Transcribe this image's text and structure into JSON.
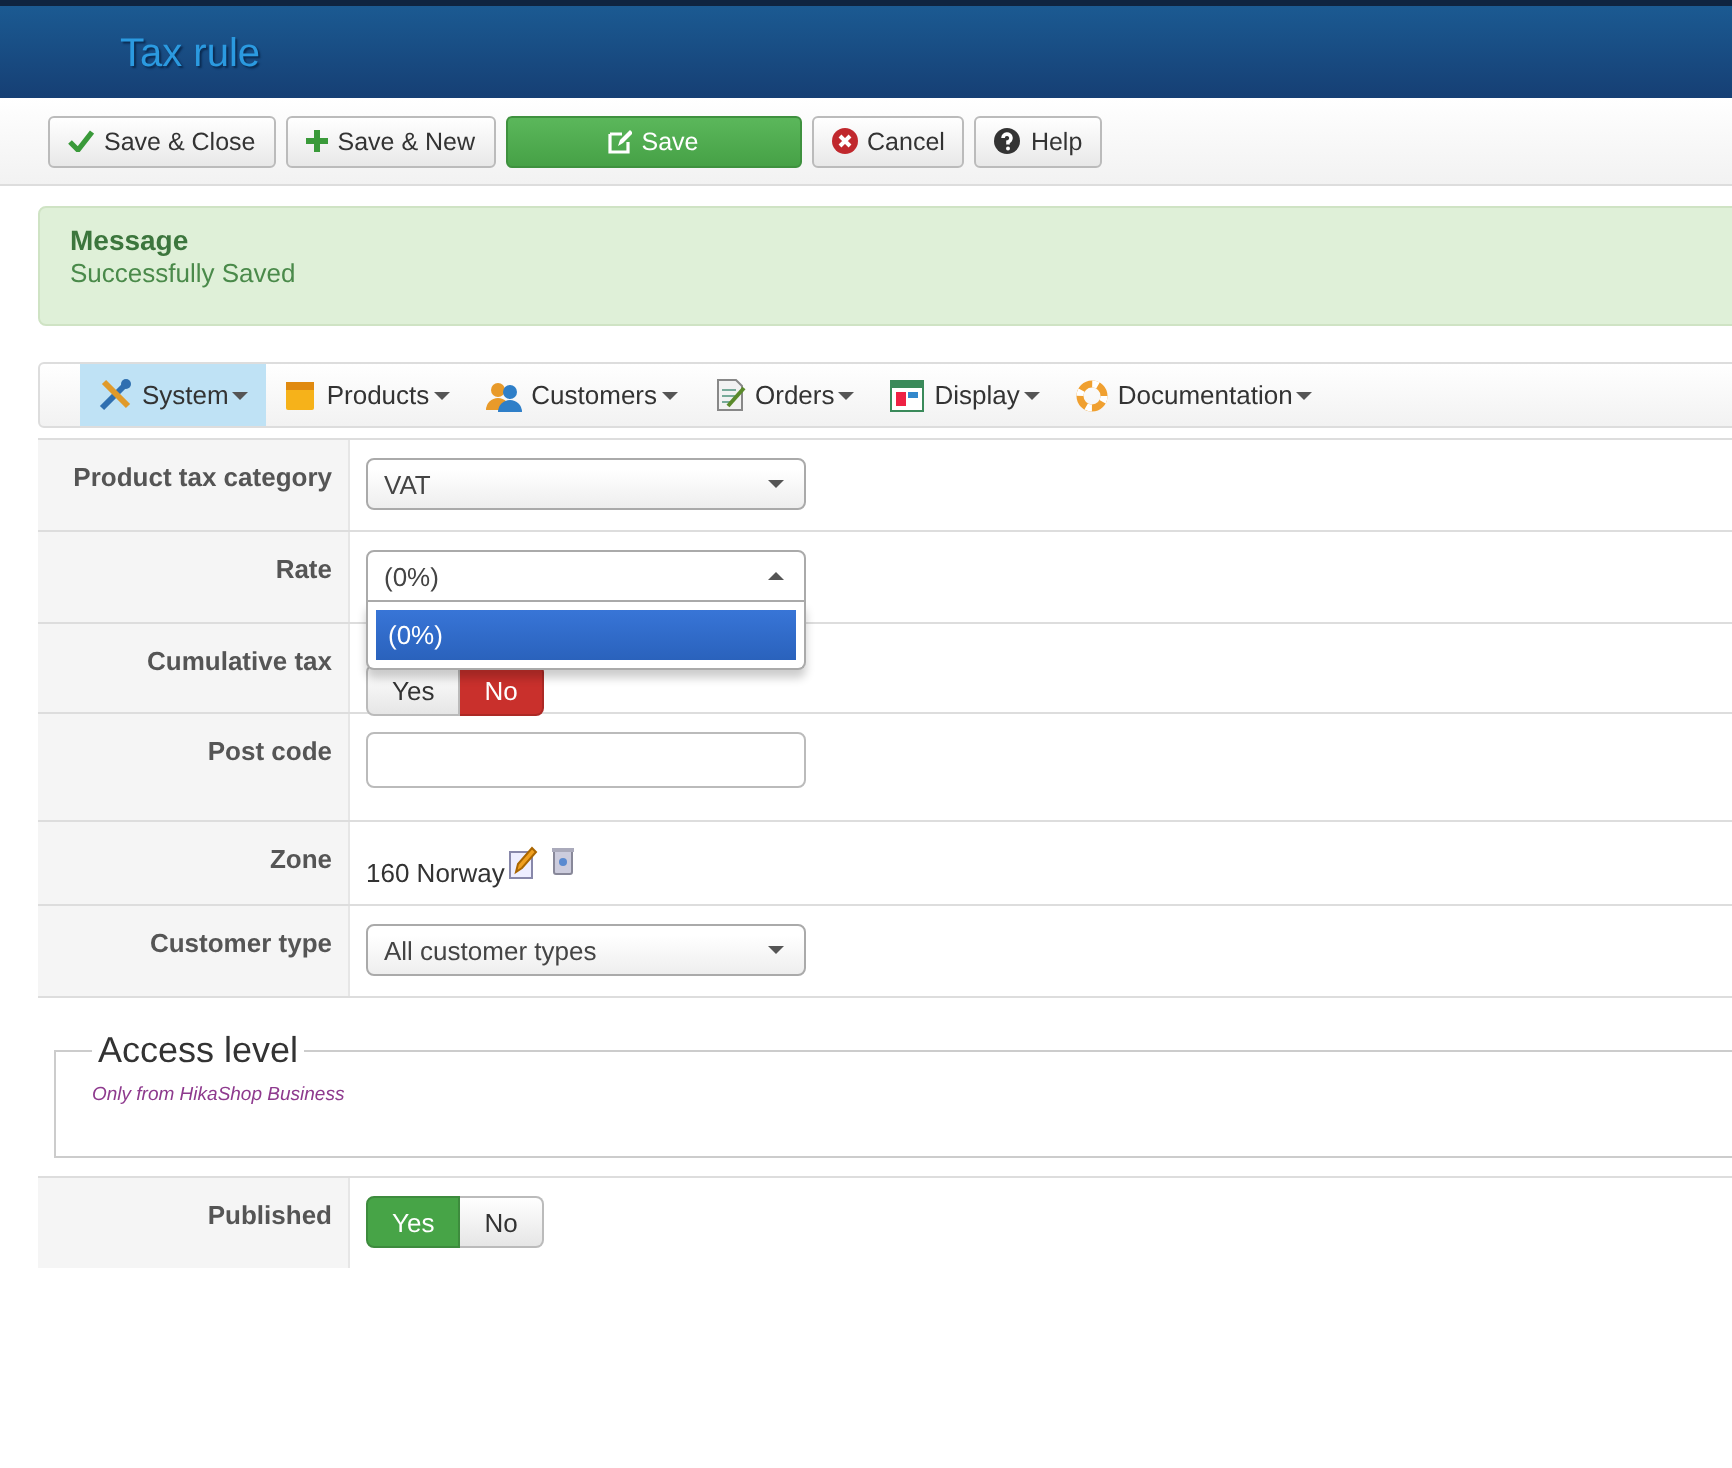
{
  "header": {
    "title": "Tax rule"
  },
  "toolbar": [
    {
      "label": "Save & Close",
      "kind": "check",
      "primary": false
    },
    {
      "label": "Save & New",
      "kind": "plus",
      "primary": false
    },
    {
      "label": "Save",
      "kind": "edit",
      "primary": true
    },
    {
      "label": "Cancel",
      "kind": "cancel",
      "primary": false
    },
    {
      "label": "Help",
      "kind": "help",
      "primary": false
    }
  ],
  "message": {
    "title": "Message",
    "text": "Successfully Saved"
  },
  "menu": [
    {
      "label": "System",
      "kind": "tools",
      "selected": true
    },
    {
      "label": "Products",
      "kind": "box",
      "selected": false
    },
    {
      "label": "Customers",
      "kind": "people",
      "selected": false
    },
    {
      "label": "Orders",
      "kind": "document",
      "selected": false
    },
    {
      "label": "Display",
      "kind": "window",
      "selected": false
    },
    {
      "label": "Documentation",
      "kind": "lifebuoy",
      "selected": false
    }
  ],
  "fields": [
    {
      "label": "Product tax category",
      "kind": "select",
      "value": "VAT",
      "expanded": false
    },
    {
      "label": "Rate",
      "kind": "select",
      "value": "(0%)",
      "expanded": true,
      "options": [
        {
          "label": "(0%)",
          "selected": true
        }
      ]
    },
    {
      "label": "Cumulative tax",
      "kind": "toggle",
      "options": [
        {
          "label": "Yes",
          "selected": false
        },
        {
          "label": "No",
          "selected": true
        }
      ]
    },
    {
      "label": "Post code",
      "kind": "input"
    },
    {
      "label": "Zone",
      "kind": "zone",
      "value": "160 Norway"
    },
    {
      "label": "Customer type",
      "kind": "select",
      "value": "All customer types",
      "expanded": false
    }
  ],
  "access_level": {
    "legend": "Access level",
    "note": "Only from HikaShop Business"
  },
  "published": {
    "label": "Published",
    "options": [
      {
        "label": "Yes",
        "selected": true
      },
      {
        "label": "No",
        "selected": false
      }
    ]
  }
}
